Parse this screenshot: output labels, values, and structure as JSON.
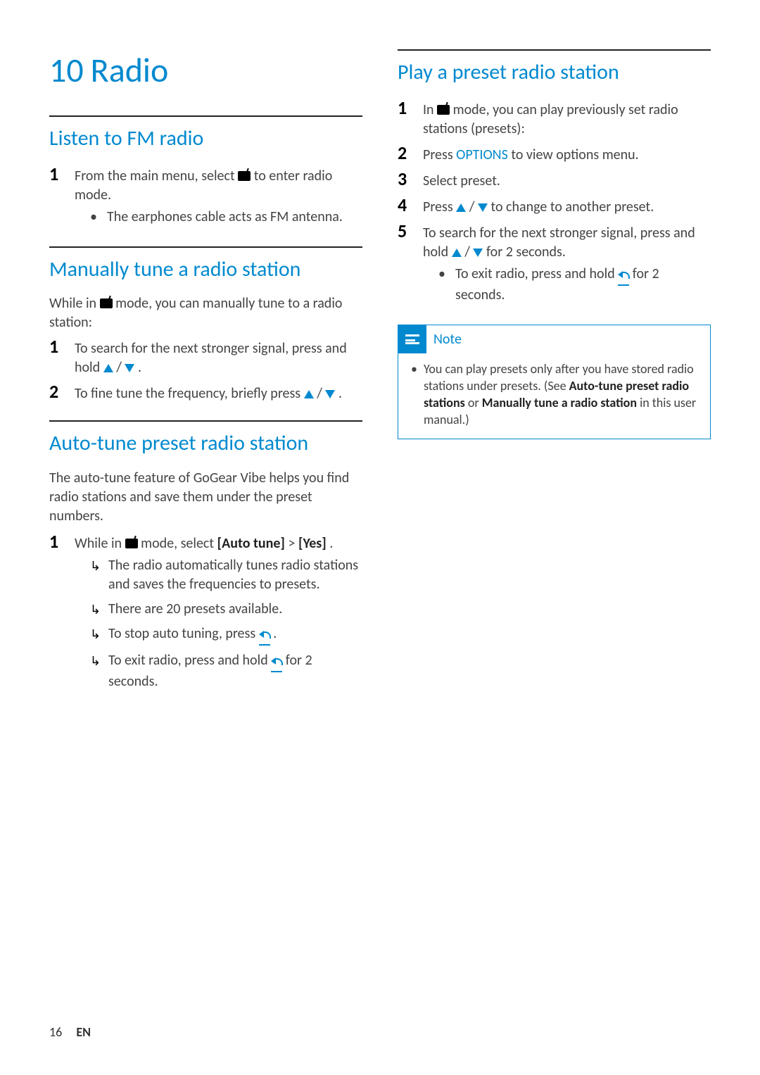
{
  "chapter": {
    "number": "10",
    "title": "Radio"
  },
  "left": {
    "s1": {
      "heading": "Listen to FM radio",
      "step1_a": "From the main menu, select ",
      "step1_b": " to enter radio mode.",
      "bullet1": "The earphones cable acts as FM antenna."
    },
    "s2": {
      "heading": "Manually tune a radio station",
      "intro_a": "While in ",
      "intro_b": " mode, you can manually tune to a radio station:",
      "step1_a": "To search for the next stronger signal, press and hold ",
      "slash": " / ",
      "period": ".",
      "step2_a": "To fine tune the frequency, briefly press "
    },
    "s3": {
      "heading": "Auto-tune preset radio station",
      "intro": "The auto-tune feature of GoGear Vibe helps you find radio stations and save them under the preset numbers.",
      "step1_a": "While in ",
      "step1_b": " mode, select ",
      "step1_bold1": "[Auto tune]",
      "step1_gt": " > ",
      "step1_bold2": "[Yes]",
      "step1_end": ".",
      "res1": "The radio automatically tunes radio stations and saves the frequencies to presets.",
      "res2": "There are 20 presets available.",
      "res3_a": "To stop auto tuning, press ",
      "res3_b": ".",
      "res4_a": "To exit radio, press and hold ",
      "res4_b": " for 2 seconds."
    }
  },
  "right": {
    "s1": {
      "heading": "Play a preset radio station",
      "step1_a": "In ",
      "step1_b": " mode, you can play previously set radio stations (presets):",
      "step2_a": "Press ",
      "step2_opt": "OPTIONS",
      "step2_b": " to view options menu.",
      "step3": "Select preset.",
      "step4_a": "Press ",
      "slash": " / ",
      "step4_b": " to change to another preset.",
      "step5_a": "To search for the next stronger signal, press and hold ",
      "step5_b": " for 2 seconds.",
      "bullet_a": "To exit radio, press and hold ",
      "bullet_b": " for 2 seconds."
    },
    "note": {
      "title": "Note",
      "body_a": "You can play presets only after you have stored radio stations under presets. (See ",
      "bold1": "Auto-tune preset radio stations",
      "or": " or ",
      "bold2": "Manually tune a radio station",
      "body_b": " in this user manual.)"
    }
  },
  "footer": {
    "page": "16",
    "lang": "EN"
  }
}
